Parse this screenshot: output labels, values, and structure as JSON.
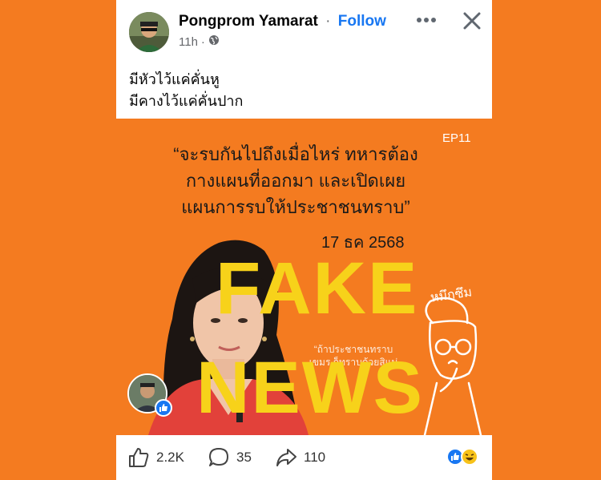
{
  "post": {
    "author": "Pongprom Yamarat",
    "separator": "·",
    "follow_label": "Follow",
    "time": "11h",
    "meta_separator": "·",
    "privacy_icon": "globe-icon",
    "caption_line1": "มีหัวไว้แค่คั่นหู",
    "caption_line2": "มีคางไว้แค่คั่นปาก"
  },
  "image": {
    "quote_line1": "“จะรบกันไปถึงเมื่อไหร่ ทหารต้อง",
    "quote_line2": "กางแผนที่ออกมา และเปิดเผย",
    "quote_line3": "แผนการรบให้ประชาชนทราบ”",
    "episode": "EP11",
    "date": "17 ธค 2568",
    "side_text": "“ถ้าประชาชนทราบ เขมร ก็ทราบด้วยสิแม่",
    "stamp_line1": "FAKE",
    "stamp_line2": "NEWS",
    "character_label": "หมึกซึม"
  },
  "footer": {
    "likes": "2.2K",
    "comments": "35",
    "shares": "110"
  },
  "colors": {
    "background": "#f47b20",
    "accent": "#1877f2",
    "stamp": "#f7d21a"
  }
}
